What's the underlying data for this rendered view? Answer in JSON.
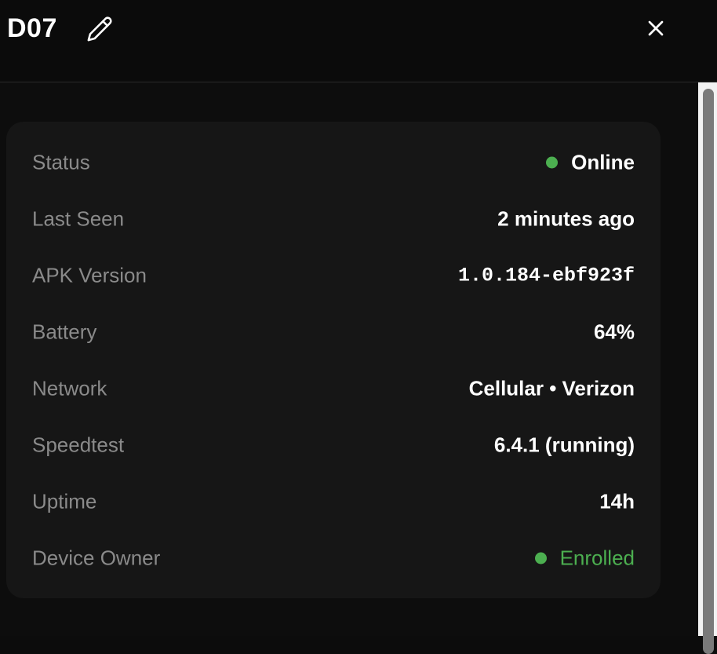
{
  "header": {
    "title": "D07"
  },
  "details": [
    {
      "label": "Status",
      "value": "Online",
      "indicator": "status-dot",
      "color": "#4caf50",
      "value_style": "default"
    },
    {
      "label": "Last Seen",
      "value": "2 minutes ago",
      "value_style": "default"
    },
    {
      "label": "APK Version",
      "value": "1.0.184-ebf923f",
      "value_style": "mono"
    },
    {
      "label": "Battery",
      "value": "64%",
      "value_style": "default"
    },
    {
      "label": "Network",
      "value": "Cellular • Verizon",
      "value_style": "default"
    },
    {
      "label": "Speedtest",
      "value": "6.4.1 (running)",
      "value_style": "default"
    },
    {
      "label": "Uptime",
      "value": "14h",
      "value_style": "default"
    },
    {
      "label": "Device Owner",
      "value": "Enrolled",
      "indicator": "status-dot",
      "color": "#4caf50",
      "value_style": "green"
    }
  ],
  "colors": {
    "background": "#0c0c0c",
    "card": "#161616",
    "label": "#8a8a8a",
    "success": "#4caf50"
  },
  "icons": {
    "edit": "pencil-icon",
    "close": "close-icon"
  }
}
